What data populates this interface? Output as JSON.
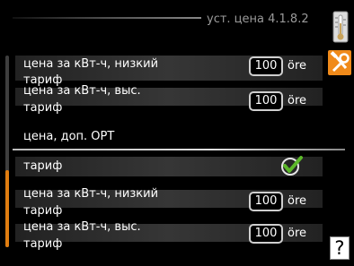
{
  "header": {
    "title": "уст. цена  4.1.8.2"
  },
  "rows_top": [
    {
      "label_line1": "цена за кВт-ч, низкий",
      "label_line2": "тариф",
      "value": "100",
      "unit": "öre"
    },
    {
      "label_line1": "цена за кВт-ч, выс.",
      "label_line2": "тариф",
      "value": "100",
      "unit": "öre"
    }
  ],
  "section": {
    "title": "цена, доп. ОРТ"
  },
  "tariff_row": {
    "label": "тариф",
    "checked": true
  },
  "rows_bottom": [
    {
      "label_line1": "цена за кВт-ч, низкий",
      "label_line2": "тариф",
      "value": "100",
      "unit": "öre"
    },
    {
      "label_line1": "цена за кВт-ч, выс.",
      "label_line2": "тариф",
      "value": "100",
      "unit": "öre"
    }
  ],
  "icons": {
    "thermometer": "thermometer-icon",
    "tools": "tools-icon",
    "help": "?",
    "check": "checkmark-icon"
  },
  "colors": {
    "accent": "#e07d10",
    "check_green": "#5cb82a",
    "background": "#000000"
  }
}
